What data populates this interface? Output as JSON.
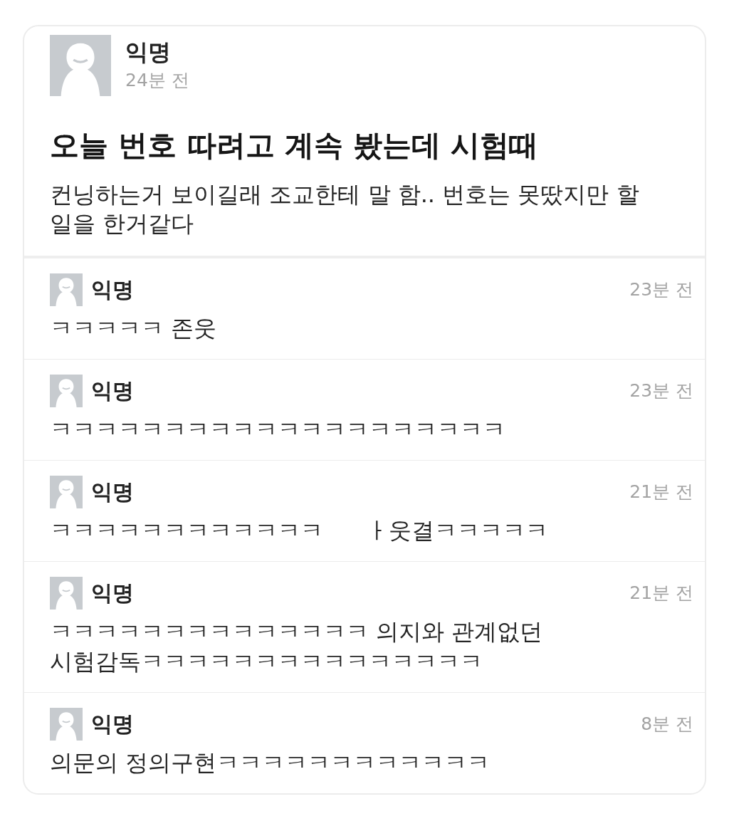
{
  "post": {
    "author": "익명",
    "time": "24분 전",
    "title": "오늘 번호 따려고 계속 봤는데 시험때",
    "body": "컨닝하는거 보이길래 조교한테 말 함.. 번호는 못땄지만 할 일을 한거같다"
  },
  "comments": [
    {
      "author": "익명",
      "time": "23분 전",
      "segments": [
        "ㅋㅋㅋㅋㅋ 존웃"
      ]
    },
    {
      "author": "익명",
      "time": "23분 전",
      "segments": [
        "ㅋㅋㅋㅋㅋㅋㅋㅋㅋㅋㅋㅋㅋㅋㅋㅋㅋㅋㅋㅋ"
      ]
    },
    {
      "author": "익명",
      "time": "21분 전",
      "segments": [
        "ㅋㅋㅋㅋㅋㅋㅋㅋㅋㅋㅋㅋ",
        "ㅏ웃결ㅋㅋㅋㅋㅋ"
      ]
    },
    {
      "author": "익명",
      "time": "21분 전",
      "segments": [
        "ㅋㅋㅋㅋㅋㅋㅋㅋㅋㅋㅋㅋㅋㅋ 의지와 관계없던 시험감독ㅋㅋㅋㅋㅋㅋㅋㅋㅋㅋㅋㅋㅋㅋㅋ"
      ]
    },
    {
      "author": "익명",
      "time": "8분 전",
      "segments": [
        "의문의 정의구현ㅋㅋㅋㅋㅋㅋㅋㅋㅋㅋㅋㅋ"
      ]
    }
  ]
}
